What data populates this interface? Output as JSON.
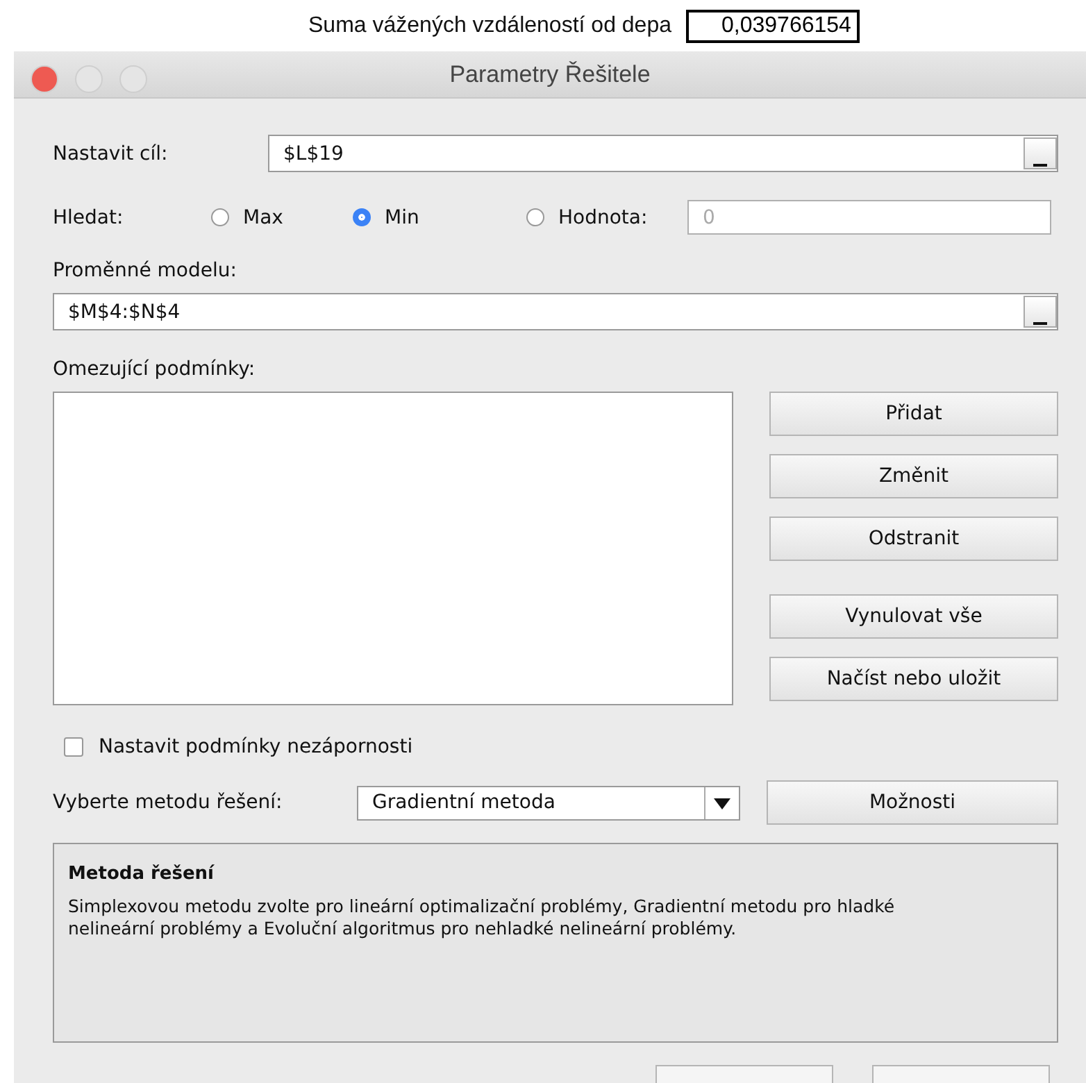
{
  "header": {
    "label": "Suma vážených vzdáleností od depa",
    "value": "0,039766154"
  },
  "window": {
    "title": "Parametry Řešitele"
  },
  "objective": {
    "label": "Nastavit cíl:",
    "value": "$L$19"
  },
  "search": {
    "label": "Hledat:",
    "options": [
      {
        "label": "Max",
        "selected": false
      },
      {
        "label": "Min",
        "selected": true
      },
      {
        "label": "Hodnota:",
        "selected": false
      }
    ],
    "value_field": {
      "placeholder": "0",
      "disabled": true
    }
  },
  "variables": {
    "label": "Proměnné modelu:",
    "value": "$M$4:$N$4"
  },
  "constraints": {
    "label": "Omezující podmínky:",
    "button_groups": [
      {
        "buttons": [
          {
            "label": "Přidat"
          },
          {
            "label": "Změnit"
          },
          {
            "label": "Odstranit"
          }
        ]
      },
      {
        "buttons": [
          {
            "label": "Vynulovat vše"
          },
          {
            "label": "Načíst nebo uložit"
          }
        ]
      }
    ]
  },
  "nonnegative": {
    "label": "Nastavit podmínky nezápornosti",
    "checked": false
  },
  "method": {
    "label": "Vyberte metodu řešení:",
    "value": "Gradientní metoda",
    "options_button": "Možnosti"
  },
  "description": {
    "title": "Metoda řešení",
    "text": "Simplexovou metodu zvolte pro lineární optimalizační problémy, Gradientní metodu pro hladké nelineární problémy a Evoluční algoritmus pro nehladké nelineární problémy."
  }
}
